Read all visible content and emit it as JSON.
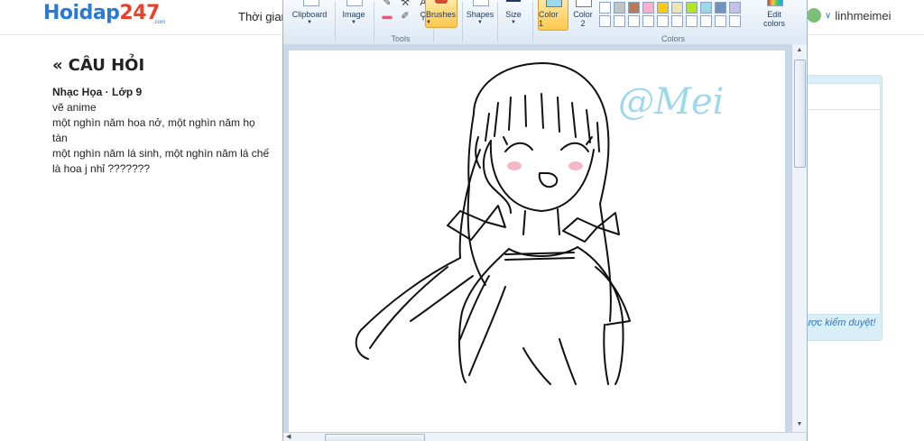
{
  "site": {
    "logo_main": "Hoidap",
    "logo_num": "247",
    "logo_sub": ".com",
    "nav_time": "Thời gian",
    "username": "linhmeimei"
  },
  "question": {
    "heading": "CÂU HỎI",
    "meta": "Nhạc Họa · Lớp 9",
    "lines": [
      "vẽ anime",
      "một nghìn năm hoa nở, một nghìn năm họ",
      "tàn",
      "một nghìn năm lá sinh, một nghìn năm lá chế",
      "là hoa j nhỉ ???????"
    ]
  },
  "sidebar": {
    "moderation_note": "ược kiểm duyệt!"
  },
  "paint": {
    "groups": {
      "clipboard": "Clipboard",
      "image": "Image",
      "tools": "Tools",
      "brushes": "Brushes",
      "shapes": "Shapes",
      "size": "Size",
      "color1_line1": "Color",
      "color1_line2": "1",
      "color2_line1": "Color",
      "color2_line2": "2",
      "edit_colors_line1": "Edit",
      "edit_colors_line2": "colors",
      "colors": "Colors"
    },
    "palette_row1": [
      "#ffffff",
      "#c3c3c3",
      "#b97a57",
      "#ffaec9",
      "#ffc90e",
      "#efe4b0",
      "#b5e61d",
      "#99d9ea",
      "#7092be",
      "#c8bfe7"
    ],
    "palette_row2": [
      "#ffffff",
      "#ffffff",
      "#ffffff",
      "#ffffff",
      "#ffffff",
      "#ffffff",
      "#ffffff",
      "#ffffff",
      "#ffffff",
      "#ffffff"
    ],
    "color1": "#99d9ea",
    "color2": "#ffffff",
    "signature": "@Mei"
  }
}
